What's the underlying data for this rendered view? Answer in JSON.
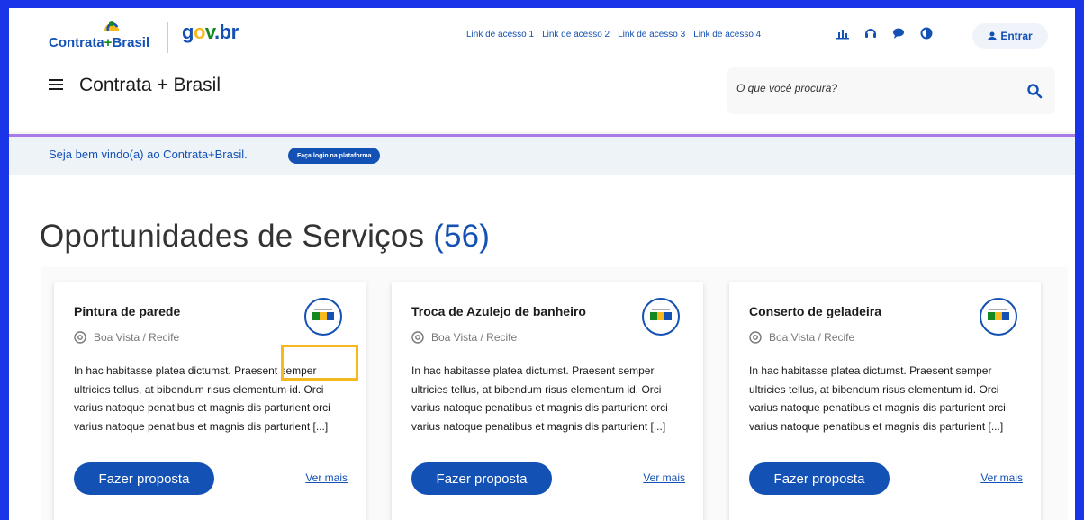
{
  "header": {
    "logo_contrata_prefix": "Contrata",
    "logo_contrata_suffix": "Brasil",
    "logo_gov": "gov.br",
    "quick_links": [
      "Link de acesso 1",
      "Link de acesso 2",
      "Link de acesso 3",
      "Link de acesso 4"
    ],
    "icons": [
      "chart-icon",
      "headset-icon",
      "chat-icon",
      "contrast-icon"
    ],
    "login_label": "Entrar",
    "site_title": "Contrata + Brasil"
  },
  "search": {
    "placeholder": "O que você procura?"
  },
  "welcome": {
    "text": "Seja bem vindo(a) ao Contrata+Brasil.",
    "button": "Faça login na plataforma"
  },
  "main": {
    "heading": "Oportunidades de Serviços",
    "count": "(56)"
  },
  "cards": [
    {
      "title": "Pintura de parede",
      "location": "Boa Vista / Recife",
      "description": "In hac habitasse platea dictumst. Praesent semper ultricies tellus, at bibendum risus elementum id. Orci varius natoque penatibus et magnis dis parturient orci varius natoque penatibus et magnis dis parturient [...]",
      "button": "Fazer proposta",
      "more": "Ver mais"
    },
    {
      "title": "Troca de Azulejo de banheiro",
      "location": "Boa Vista / Recife",
      "description": "In hac habitasse platea dictumst. Praesent semper ultricies tellus, at bibendum risus elementum id. Orci varius natoque penatibus et magnis dis parturient orci varius natoque penatibus et magnis dis parturient [...]",
      "button": "Fazer proposta",
      "more": "Ver mais"
    },
    {
      "title": "Conserto de geladeira",
      "location": "Boa Vista / Recife",
      "description": "In hac habitasse platea dictumst. Praesent semper ultricies tellus, at bibendum risus elementum id. Orci varius natoque penatibus et magnis dis parturient orci varius natoque penatibus et magnis dis parturient [...]",
      "button": "Fazer proposta",
      "more": "Ver mais"
    }
  ],
  "colors": {
    "primary": "#1351b4",
    "frame": "#1a35e8",
    "highlight": "#f5b821",
    "welcome_border": "#a87be8"
  }
}
